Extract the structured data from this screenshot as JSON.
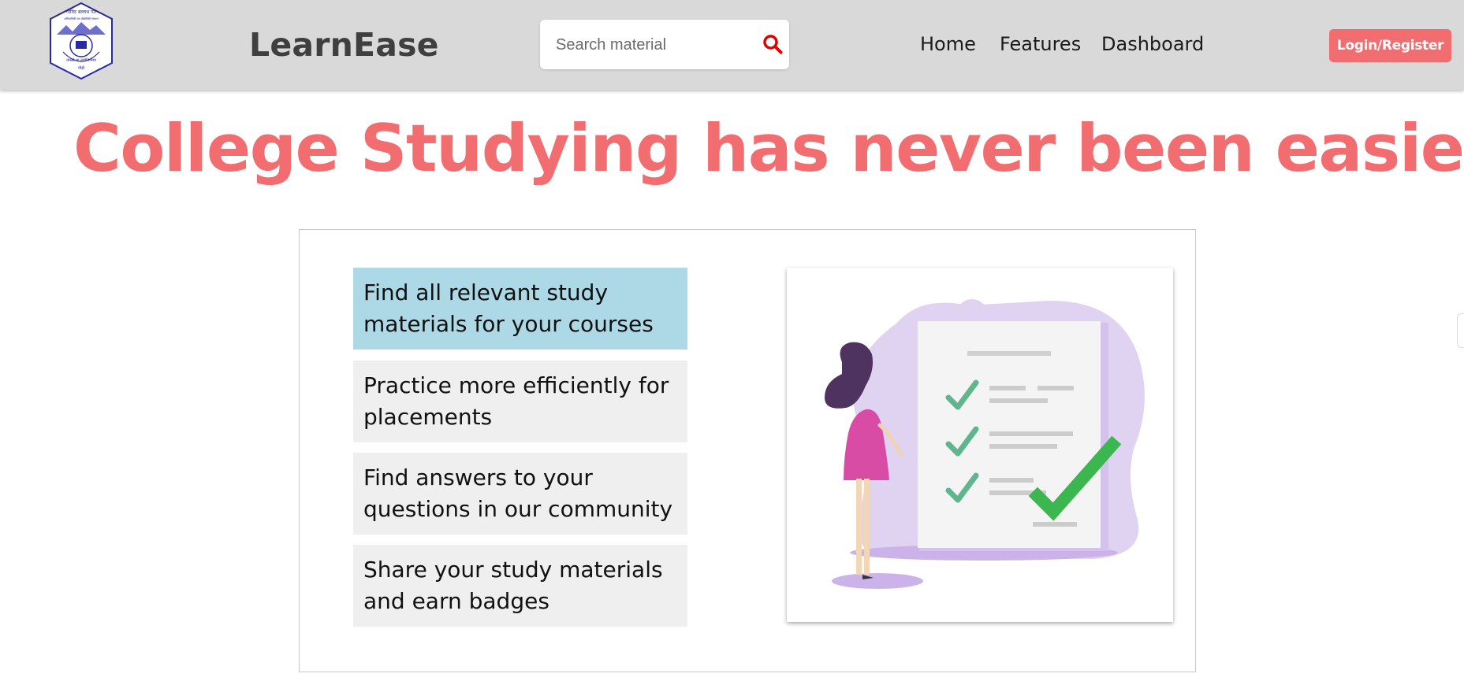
{
  "navbar": {
    "logo": {
      "icon": "college-emblem-icon",
      "text_lines": [
        "गोविंद बल्लभ पंत",
        "अभियांत्रिकी एवं प्रौद्योगिकी संस्थान",
        "तमसो मा ज्योतिर्गमय",
        "पौड़ी"
      ]
    },
    "brand": "LearnEase",
    "search": {
      "placeholder": "Search material",
      "value": "",
      "icon": "search-icon",
      "icon_color": "#e00000"
    },
    "links": [
      {
        "label": "Home"
      },
      {
        "label": "Features"
      },
      {
        "label": "Dashboard"
      }
    ],
    "login_button": "Login/Register",
    "background": "#d9d9d9"
  },
  "hero": {
    "title": "College Studying has never been easier",
    "accent_color": "#f26d70"
  },
  "features": [
    {
      "text": "Find all relevant study materials for your courses",
      "active": true
    },
    {
      "text": "Practice more efficiently for placements",
      "active": false
    },
    {
      "text": "Find answers to your questions in our community",
      "active": false
    },
    {
      "text": "Share your study materials and earn badges",
      "active": false
    }
  ],
  "colors": {
    "active_feature": "#add8e6",
    "inactive_feature": "#efefef"
  },
  "illustration": {
    "icon": "checklist-illustration-icon",
    "description_icons": [
      "woman-figure-icon",
      "checklist-document-icon",
      "big-checkmark-icon"
    ]
  }
}
